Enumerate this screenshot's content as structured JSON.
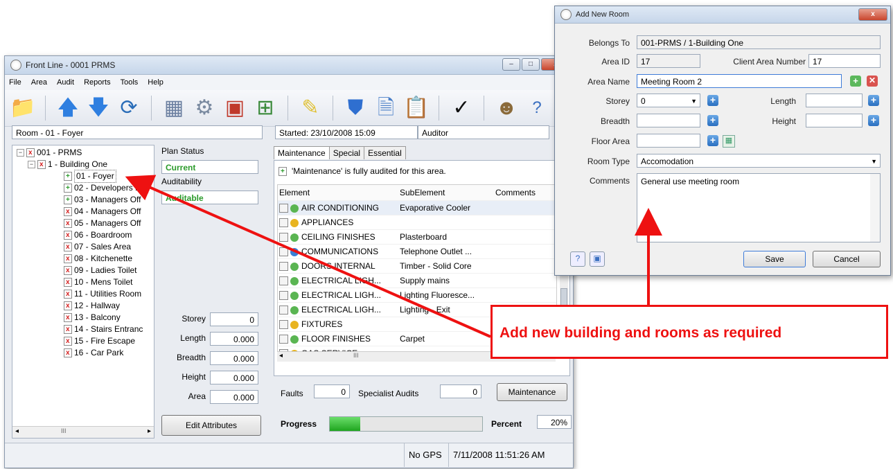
{
  "main_window": {
    "title": "Front Line - 0001 PRMS",
    "menu": [
      "File",
      "Area",
      "Audit",
      "Reports",
      "Tools",
      "Help"
    ],
    "room_label": "Room - 01 - Foyer",
    "started_label": "Started: 23/10/2008 15:09",
    "auditor_label": "Auditor"
  },
  "toolbar_icons": [
    "open-folder-icon",
    "up-arrow-icon",
    "down-arrow-icon",
    "refresh-icon",
    "building-icon",
    "gears-icon",
    "bricks-icon",
    "add-grid-icon",
    "notes-icon",
    "shield-icon",
    "document-icon",
    "clipboard-icon",
    "checkmark-icon",
    "user-icon",
    "help-icon"
  ],
  "tree": {
    "root": "001 - PRMS",
    "building": "1 - Building One",
    "rooms": [
      "01 - Foyer",
      "02 - Developers F",
      "03 - Managers Off",
      "04 - Managers Off",
      "05 - Managers Off",
      "06 - Boardroom",
      "07 - Sales Area",
      "08 - Kitchenette",
      "09 - Ladies Toilet",
      "10 - Mens Toilet",
      "11 - Utilities Room",
      "12 - Hallway",
      "13 - Balcony",
      "14 - Stairs Entranc",
      "15 - Fire Escape",
      "16 - Car Park"
    ],
    "scroll_glyph": "III"
  },
  "plan": {
    "status_label": "Plan Status",
    "status_value": "Current",
    "auditability_label": "Auditability",
    "auditability_value": "Auditable",
    "storey_label": "Storey",
    "storey_value": "0",
    "length_label": "Length",
    "length_value": "0.000",
    "breadth_label": "Breadth",
    "breadth_value": "0.000",
    "height_label": "Height",
    "height_value": "0.000",
    "area_label": "Area",
    "area_value": "0.000",
    "edit_button": "Edit Attributes"
  },
  "tabs": [
    "Maintenance",
    "Special",
    "Essential"
  ],
  "audit_message": "'Maintenance' is fully audited for this area.",
  "grid": {
    "headers": [
      "Element",
      "SubElement",
      "Comments"
    ],
    "rows": [
      {
        "element": "AIR CONDITIONING",
        "sub": "Evaporative Cooler",
        "color": "#5ab552"
      },
      {
        "element": "APPLIANCES",
        "sub": "",
        "color": "#e8b420"
      },
      {
        "element": "CEILING FINISHES",
        "sub": "Plasterboard",
        "color": "#5ab552"
      },
      {
        "element": "COMMUNICATIONS",
        "sub": "Telephone Outlet ...",
        "color": "#3a7fd6"
      },
      {
        "element": "DOORS INTERNAL",
        "sub": "Timber - Solid Core",
        "color": "#5ab552"
      },
      {
        "element": "ELECTRICAL LIGH...",
        "sub": "Supply mains",
        "color": "#5ab552"
      },
      {
        "element": "ELECTRICAL LIGH...",
        "sub": "Lighting Fluoresce...",
        "color": "#5ab552"
      },
      {
        "element": "ELECTRICAL LIGH...",
        "sub": "Lighting - Exit",
        "color": "#5ab552"
      },
      {
        "element": "FIXTURES",
        "sub": "",
        "color": "#e8b420"
      },
      {
        "element": "FLOOR FINISHES",
        "sub": "Carpet",
        "color": "#5ab552"
      },
      {
        "element": "GAS SERVICE",
        "sub": "",
        "color": "#e8b420"
      }
    ],
    "scroll_glyph": "III"
  },
  "bottom": {
    "faults_label": "Faults",
    "faults_value": "0",
    "specialist_label": "Specialist Audits",
    "specialist_value": "0",
    "maintenance_button": "Maintenance",
    "progress_label": "Progress",
    "progress_fraction": 0.2,
    "percent_label": "Percent",
    "percent_value": "20%"
  },
  "status_bar": {
    "gps": "No GPS",
    "datetime": "7/11/2008 11:51:26 AM"
  },
  "dialog": {
    "title": "Add New Room",
    "belongs_to_label": "Belongs To",
    "belongs_to_value": "001-PRMS / 1-Building One",
    "area_id_label": "Area ID",
    "area_id_value": "17",
    "client_area_label": "Client Area Number",
    "client_area_value": "17",
    "area_name_label": "Area Name",
    "area_name_value": "Meeting Room 2",
    "storey_label": "Storey",
    "storey_value": "0",
    "length_label": "Length",
    "length_value": "",
    "breadth_label": "Breadth",
    "breadth_value": "",
    "height_label": "Height",
    "height_value": "",
    "floor_area_label": "Floor Area",
    "floor_area_value": "",
    "room_type_label": "Room Type",
    "room_type_value": "Accomodation",
    "comments_label": "Comments",
    "comments_value": "General use meeting room",
    "save_button": "Save",
    "cancel_button": "Cancel"
  },
  "callout": {
    "text": "Add new building and rooms as required",
    "color": "#ee1111"
  }
}
